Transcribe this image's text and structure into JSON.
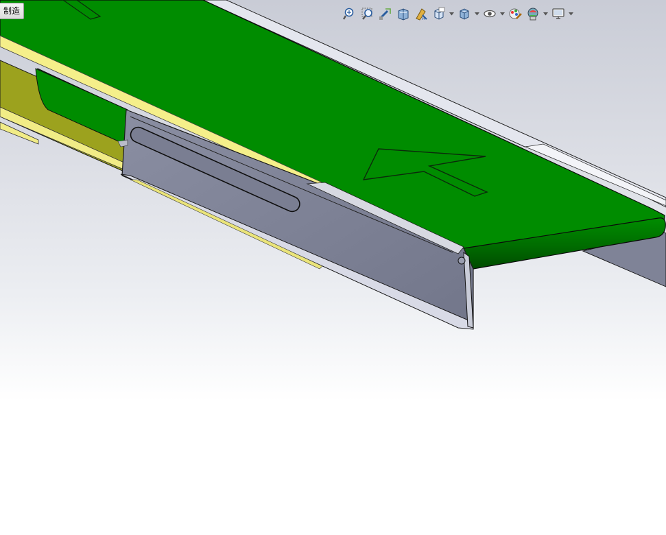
{
  "tab": {
    "label": "制造"
  },
  "toolbar": {
    "buttons": [
      {
        "name": "zoom-to-fit-icon",
        "dropdown": false
      },
      {
        "name": "zoom-to-area-icon",
        "dropdown": false
      },
      {
        "name": "previous-view-icon",
        "dropdown": false
      },
      {
        "name": "section-view-icon",
        "dropdown": false
      },
      {
        "name": "dynamic-annotation-views-icon",
        "dropdown": false
      },
      {
        "name": "view-orientation-icon",
        "dropdown": true
      },
      {
        "name": "display-style-icon",
        "dropdown": true
      },
      {
        "name": "hide-show-items-icon",
        "dropdown": true
      },
      {
        "name": "edit-appearance-icon",
        "dropdown": false
      },
      {
        "name": "apply-scene-icon",
        "dropdown": true
      },
      {
        "name": "view-settings-icon",
        "dropdown": true
      }
    ]
  },
  "colors": {
    "belt": "#008c00",
    "belt_dark": "#006400",
    "frame": "#7e8296",
    "frame_light": "#c6c9d6",
    "rail_yellow": "#f4ee8a",
    "panel_olive": "#9ca21e",
    "edge": "#1a1a1a"
  }
}
